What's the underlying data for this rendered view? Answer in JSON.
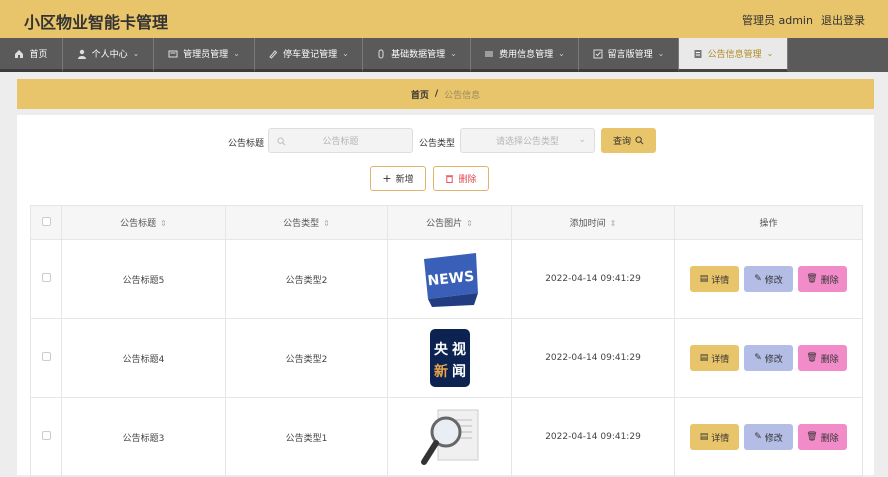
{
  "header": {
    "title": "小区物业智能卡管理",
    "user": "管理员 admin",
    "logout": "退出登录"
  },
  "nav": [
    {
      "label": "首页",
      "icon": "home-icon"
    },
    {
      "label": "个人中心",
      "icon": "user-icon"
    },
    {
      "label": "管理员管理",
      "icon": "admin-icon"
    },
    {
      "label": "停车登记管理",
      "icon": "parking-icon"
    },
    {
      "label": "基础数据管理",
      "icon": "data-icon"
    },
    {
      "label": "费用信息管理",
      "icon": "fee-icon"
    },
    {
      "label": "留言版管理",
      "icon": "message-icon"
    },
    {
      "label": "公告信息管理",
      "icon": "notice-icon",
      "active": true
    }
  ],
  "breadcrumb": {
    "home": "首页",
    "sep": "/",
    "current": "公告信息"
  },
  "search": {
    "title_label": "公告标题",
    "title_placeholder": "公告标题",
    "type_label": "公告类型",
    "type_placeholder": "请选择公告类型",
    "query_label": "查询"
  },
  "actions": {
    "add_label": "新增",
    "delete_label": "删除"
  },
  "table": {
    "headers": [
      "公告标题",
      "公告类型",
      "公告图片",
      "添加时间",
      "操作"
    ],
    "rows": [
      {
        "title": "公告标题5",
        "type": "公告类型2",
        "time": "2022-04-14 09:41:29",
        "image": "news-3d-text"
      },
      {
        "title": "公告标题4",
        "type": "公告类型2",
        "time": "2022-04-14 09:41:29",
        "image": "cctv-news-logo"
      },
      {
        "title": "公告标题3",
        "type": "公告类型1",
        "time": "2022-04-14 09:41:29",
        "image": "magnifier-newspaper"
      }
    ],
    "op_labels": {
      "detail": "详情",
      "edit": "修改",
      "delete": "删除"
    }
  },
  "cctv_logo_text": [
    "央",
    "视",
    "新",
    "闻"
  ],
  "news_text": "NEWS",
  "colors": {
    "accent": "#e8c46a",
    "nav_bg": "#5a5a5a",
    "edit": "#b3bde6",
    "delete": "#f28cc8",
    "danger": "#e2494d"
  }
}
